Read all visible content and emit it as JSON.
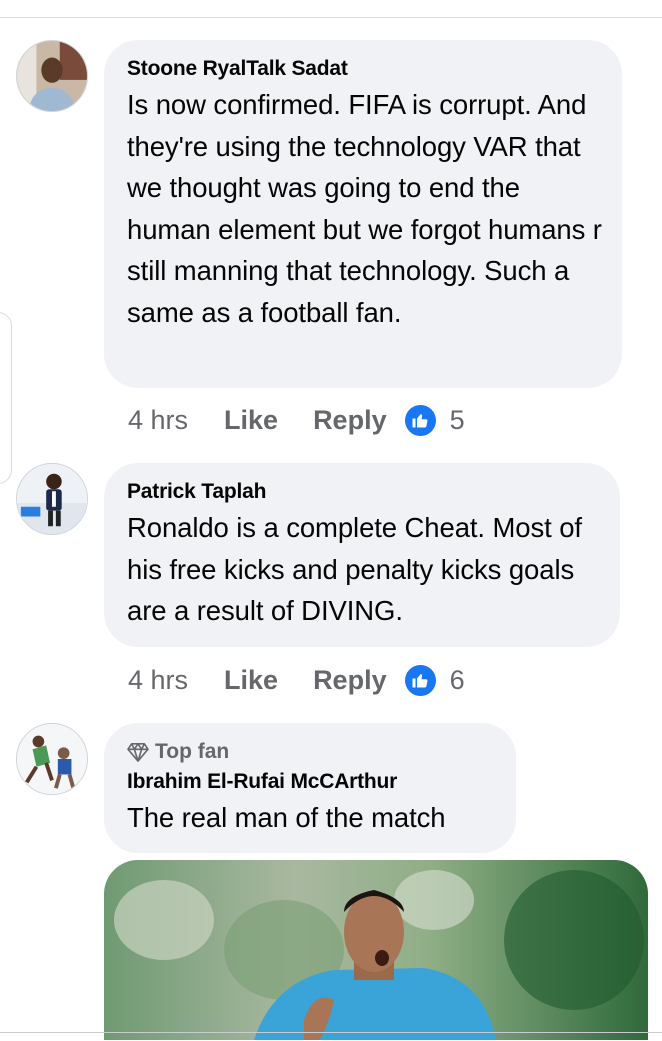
{
  "comments": [
    {
      "author": "Stoone RyalTalk Sadat",
      "text": "Is now confirmed. FIFA is corrupt. And they're using the technology VAR that we thought was going to end the human element but we forgot humans r still manning that technology.  Such a same as a football fan.",
      "time": "4 hrs",
      "like_label": "Like",
      "reply_label": "Reply",
      "reaction_icon": "like-icon",
      "reaction_count": "5"
    },
    {
      "author": "Patrick Taplah",
      "text": "Ronaldo is a complete Cheat. Most of his free kicks and penalty kicks goals are a result of DIVING.",
      "time": "4 hrs",
      "like_label": "Like",
      "reply_label": "Reply",
      "reaction_icon": "like-icon",
      "reaction_count": "6"
    },
    {
      "badge": "Top fan",
      "badge_icon": "diamond-icon",
      "author": "Ibrahim El-Rufai McCArthur",
      "text": "The real man of the match",
      "attachment": "referee-photo"
    }
  ],
  "colors": {
    "bubble": "#f0f2f5",
    "meta_text": "#65676b",
    "like_blue": "#1877f2",
    "body_text": "#050505"
  }
}
